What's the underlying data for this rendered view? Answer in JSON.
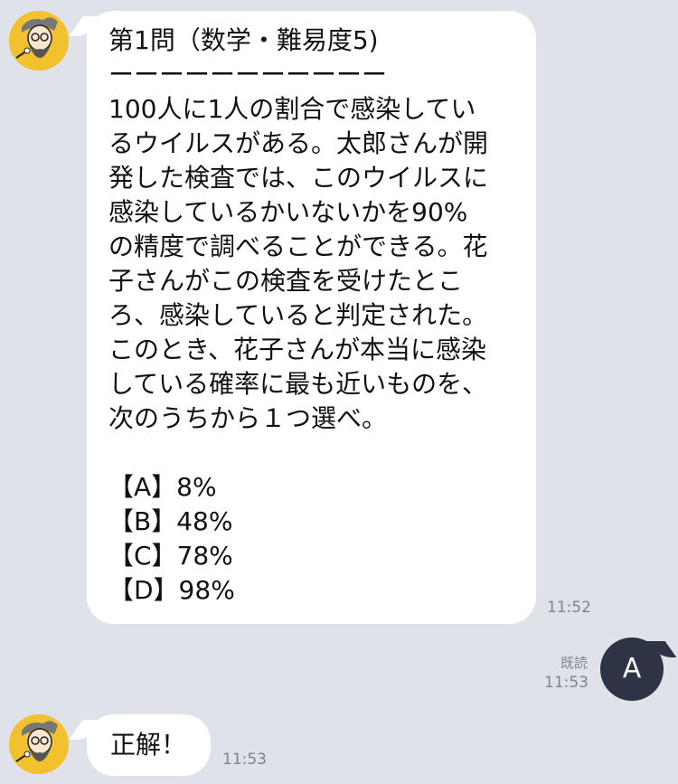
{
  "messages": {
    "question": {
      "lines": [
        "第1問（数学・難易度5)",
        "ーーーーーーーーーーー",
        "100人に1人の割合で感染してい",
        "るウイルスがある。太郎さんが開",
        "発した検査では、このウイルスに",
        "感染しているかいないかを90%",
        "の精度で調べることができる。花",
        "子さんがこの検査を受けたとこ",
        "ろ、感染していると判定された。",
        "このとき、花子さんが本当に感染",
        "している確率に最も近いものを、",
        "次のうちから１つ選べ。",
        "",
        "【A】8%",
        "【B】48%",
        "【C】78%",
        "【D】98%"
      ],
      "time": "11:52"
    },
    "answer": {
      "text": "A",
      "read_label": "既読",
      "time": "11:53"
    },
    "reply": {
      "text": "正解！",
      "time": "11:53"
    }
  },
  "colors": {
    "background": "#dfe2e9",
    "bubble_in": "#ffffff",
    "bubble_out": "#2e3446",
    "avatar_bg": "#f2c12e"
  }
}
